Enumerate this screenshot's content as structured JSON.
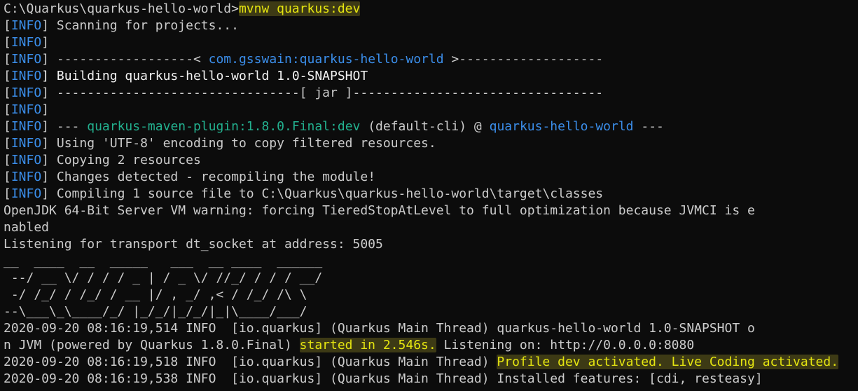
{
  "theme": {
    "background": "#0c0c0c",
    "text": "#cccccc",
    "info": "#3b8eea",
    "artifact": "#3b8eea",
    "plugin": "#23b18f",
    "highlight": "#e5e510"
  },
  "lines": [
    [
      {
        "text": "C:\\Quarkus\\quarkus-hello-world>",
        "c": "default"
      },
      {
        "text": "mvnw quarkus:dev",
        "c": "yellow",
        "hl": true
      }
    ],
    [
      {
        "text": "[",
        "c": "bracket"
      },
      {
        "text": "INFO",
        "c": "info"
      },
      {
        "text": "] Scanning for projects...",
        "c": "default"
      }
    ],
    [
      {
        "text": "[",
        "c": "bracket"
      },
      {
        "text": "INFO",
        "c": "info"
      },
      {
        "text": "]",
        "c": "default"
      }
    ],
    [
      {
        "text": "[",
        "c": "bracket"
      },
      {
        "text": "INFO",
        "c": "info"
      },
      {
        "text": "] ------------------< ",
        "c": "default"
      },
      {
        "text": "com.gsswain:quarkus-hello-world",
        "c": "blue"
      },
      {
        "text": " >-------------------",
        "c": "default"
      }
    ],
    [
      {
        "text": "[",
        "c": "bracket"
      },
      {
        "text": "INFO",
        "c": "info"
      },
      {
        "text": "] Building quarkus-hello-world 1.0-SNAPSHOT",
        "c": "white"
      }
    ],
    [
      {
        "text": "[",
        "c": "bracket"
      },
      {
        "text": "INFO",
        "c": "info"
      },
      {
        "text": "] --------------------------------[ jar ]---------------------------------",
        "c": "default"
      }
    ],
    [
      {
        "text": "[",
        "c": "bracket"
      },
      {
        "text": "INFO",
        "c": "info"
      },
      {
        "text": "]",
        "c": "default"
      }
    ],
    [
      {
        "text": "[",
        "c": "bracket"
      },
      {
        "text": "INFO",
        "c": "info"
      },
      {
        "text": "] --- ",
        "c": "default"
      },
      {
        "text": "quarkus-maven-plugin:1.8.0.Final:dev",
        "c": "green"
      },
      {
        "text": " (default-cli) @ ",
        "c": "default"
      },
      {
        "text": "quarkus-hello-world",
        "c": "blue"
      },
      {
        "text": " ---",
        "c": "default"
      }
    ],
    [
      {
        "text": "[",
        "c": "bracket"
      },
      {
        "text": "INFO",
        "c": "info"
      },
      {
        "text": "] Using 'UTF-8' encoding to copy filtered resources.",
        "c": "default"
      }
    ],
    [
      {
        "text": "[",
        "c": "bracket"
      },
      {
        "text": "INFO",
        "c": "info"
      },
      {
        "text": "] Copying 2 resources",
        "c": "default"
      }
    ],
    [
      {
        "text": "[",
        "c": "bracket"
      },
      {
        "text": "INFO",
        "c": "info"
      },
      {
        "text": "] Changes detected - recompiling the module!",
        "c": "default"
      }
    ],
    [
      {
        "text": "[",
        "c": "bracket"
      },
      {
        "text": "INFO",
        "c": "info"
      },
      {
        "text": "] Compiling 1 source file to C:\\Quarkus\\quarkus-hello-world\\target\\classes",
        "c": "default"
      }
    ],
    [
      {
        "text": "OpenJDK 64-Bit Server VM warning: forcing TieredStopAtLevel to full optimization because JVMCI is e",
        "c": "default"
      }
    ],
    [
      {
        "text": "nabled",
        "c": "default"
      }
    ],
    [
      {
        "text": "Listening for transport dt_socket at address: 5005",
        "c": "default"
      }
    ],
    [
      {
        "text": "__  ____  __  _____   ___  __ ____  ______ ",
        "c": "default"
      }
    ],
    [
      {
        "text": " --/ __ \\/ / / / _ | / _ \\/ //_/ / / / __/ ",
        "c": "default"
      }
    ],
    [
      {
        "text": " -/ /_/ / /_/ / __ |/ , _/ ,< / /_/ /\\ \\   ",
        "c": "default"
      }
    ],
    [
      {
        "text": "--\\___\\_\\____/_/ |_/_/|_/_/|_|\\____/___/   ",
        "c": "default"
      }
    ],
    [
      {
        "text": "2020-09-20 08:16:19,514 INFO  [io.quarkus] (Quarkus Main Thread) quarkus-hello-world 1.0-SNAPSHOT o",
        "c": "default"
      }
    ],
    [
      {
        "text": "n JVM (powered by Quarkus 1.8.0.Final) ",
        "c": "default"
      },
      {
        "text": "started in 2.546s.",
        "c": "yellow",
        "hl": true
      },
      {
        "text": " Listening on: http://0.0.0.0:8080",
        "c": "default"
      }
    ],
    [
      {
        "text": "2020-09-20 08:16:19,518 INFO  [io.quarkus] (Quarkus Main Thread) ",
        "c": "default"
      },
      {
        "text": "Profile dev activated. Live Coding activated.",
        "c": "yellow",
        "hl": true
      }
    ],
    [
      {
        "text": "2020-09-20 08:16:19,538 INFO  [io.quarkus] (Quarkus Main Thread) Installed features: [cdi, resteasy]",
        "c": "default"
      }
    ]
  ]
}
